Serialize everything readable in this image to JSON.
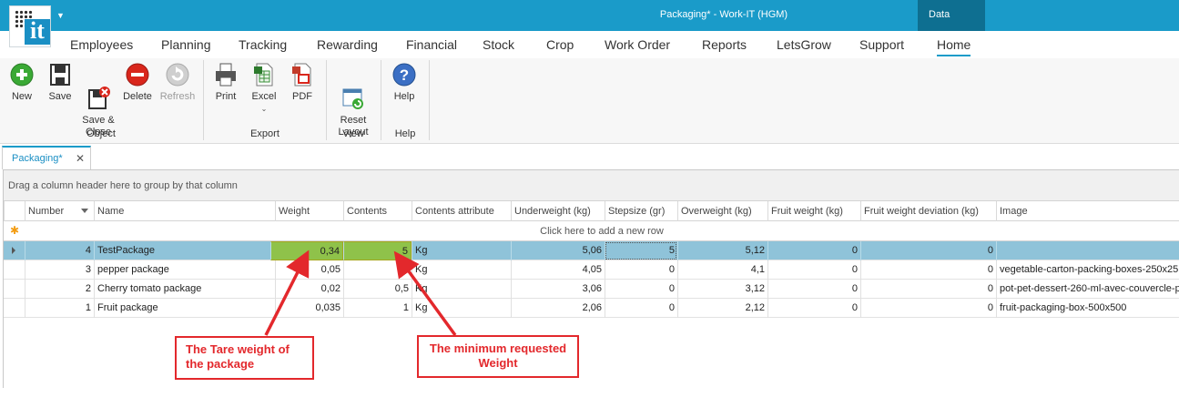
{
  "window": {
    "title": "Packaging* - Work-IT (HGM)",
    "data_tab": "Data"
  },
  "logo": {
    "text": "it"
  },
  "menu": [
    {
      "label": "Employees"
    },
    {
      "label": "Planning"
    },
    {
      "label": "Tracking"
    },
    {
      "label": "Rewarding"
    },
    {
      "label": "Financial"
    },
    {
      "label": "Stock"
    },
    {
      "label": "Crop"
    },
    {
      "label": "Work Order"
    },
    {
      "label": "Reports"
    },
    {
      "label": "LetsGrow"
    },
    {
      "label": "Support"
    },
    {
      "label": "Home",
      "active": true
    }
  ],
  "ribbon": {
    "buttons": {
      "new": "New",
      "save": "Save",
      "save_close": "Save &\nClose",
      "delete": "Delete",
      "refresh": "Refresh",
      "print": "Print",
      "excel": "Excel",
      "pdf": "PDF",
      "reset_layout": "Reset\nLayout",
      "help": "Help"
    },
    "groups": {
      "object": "Object",
      "export": "Export",
      "view": "View",
      "help": "Help"
    }
  },
  "doc_tab": {
    "label": "Packaging*"
  },
  "grid": {
    "group_panel": "Drag a column header here to group by that column",
    "columns": [
      "Number",
      "Name",
      "Weight",
      "Contents",
      "Contents attribute",
      "Underweight (kg)",
      "Stepsize (gr)",
      "Overweight (kg)",
      "Fruit weight  (kg)",
      "Fruit weight deviation  (kg)",
      "Image"
    ],
    "new_row": "Click here to add a new row",
    "rows": [
      {
        "number": "4",
        "name": "TestPackage",
        "weight": "0,34",
        "contents": "5",
        "attr": "Kg",
        "under": "5,06",
        "step": "5",
        "over": "5,12",
        "fruit": "0",
        "dev": "0",
        "image": ""
      },
      {
        "number": "3",
        "name": "pepper package",
        "weight": "0,05",
        "contents": "",
        "attr": "Kg",
        "under": "4,05",
        "step": "0",
        "over": "4,1",
        "fruit": "0",
        "dev": "0",
        "image": "vegetable-carton-packing-boxes-250x25"
      },
      {
        "number": "2",
        "name": "Cherry tomato package",
        "weight": "0,02",
        "contents": "0,5",
        "attr": "Kg",
        "under": "3,06",
        "step": "0",
        "over": "3,12",
        "fruit": "0",
        "dev": "0",
        "image": "pot-pet-dessert-260-ml-avec-couvercle-p"
      },
      {
        "number": "1",
        "name": "Fruit package",
        "weight": "0,035",
        "contents": "1",
        "attr": "Kg",
        "under": "2,06",
        "step": "0",
        "over": "2,12",
        "fruit": "0",
        "dev": "0",
        "image": "fruit-packaging-box-500x500"
      }
    ]
  },
  "annotations": {
    "tare": "The Tare weight of the package",
    "minimum": "The minimum requested Weight"
  },
  "colors": {
    "accent": "#1a9bc9",
    "selected_row": "#8fc3d9",
    "highlight": "#8fc24a",
    "annotation": "#e3282c"
  }
}
